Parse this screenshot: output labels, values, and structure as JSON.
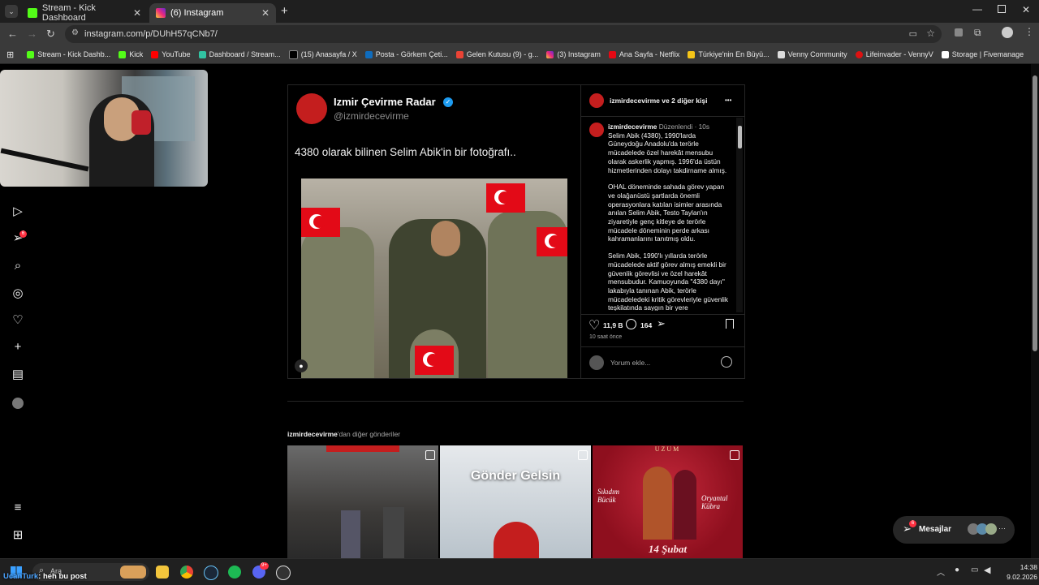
{
  "browser": {
    "tabs": [
      {
        "label": "Stream - Kick Dashboard",
        "active": false,
        "icon": "kick-icon"
      },
      {
        "label": "(6) Instagram",
        "active": true,
        "icon": "instagram-icon"
      }
    ],
    "new_tab_symbol": "+",
    "url": "instagram.com/p/DUhH57qCNb7/",
    "bookmarks": [
      "Stream - Kick Dashb...",
      "Kick",
      "YouTube",
      "Dashboard / Stream...",
      "(15) Anasayfa / X",
      "Posta - Görkem Çeti...",
      "Gelen Kutusu (9) - g...",
      "(3) Instagram",
      "Ana Sayfa - Netflix",
      "Türkiye'nin En Büyü...",
      "Venny Community",
      "Lifeinvader - VennyV",
      "Storage | Fivemanage"
    ]
  },
  "sidebar": {
    "notification_badge": "6"
  },
  "post": {
    "media": {
      "tweet_author": "Izmir Çevirme Radar",
      "tweet_handle": "@izmirdecevirme",
      "tweet_text": "4380 olarak bilinen Selim Abik'in bir fotoğrafı.."
    },
    "header": {
      "author_line": "izmirdecevirme ve 2 diğer kişi",
      "more": "•••"
    },
    "caption": {
      "username": "izmirdecevirme",
      "edited": "Düzenlendi",
      "dot": "·",
      "time": "10s",
      "p1": "Selim Abik (4380), 1990'larda Güneydoğu Anadolu'da terörle mücadelede özel harekât mensubu olarak askerlik yapmış. 1996'da üstün hizmetlerinden dolayı takdirname almış.",
      "p2": "OHAL döneminde sahada görev yapan ve olağanüstü şartlarda önemli operasyonlara katılan isimler arasında anılan Selim Abik, Testo Taylan'ın ziyaretiyle genç kitleye de terörle mücadele döneminin perde arkası kahramanlarını tanıtmış oldu.",
      "p3": "Selim Abik, 1990'lı yıllarda terörle mücadelede aktif görev almış emekli bir güvenlik görevlisi ve özel harekât mensubudur. Kamuoyunda \"4380 dayı\" lakabıyla tanınan Abik, terörle mücadeledeki kritik görevleriyle güvenlik teşkilatında saygın bir yere"
    },
    "actions": {
      "likes": "11,9 B",
      "comments": "164",
      "time_ago": "10 saat önce",
      "comment_placeholder": "Yorum ekle..."
    }
  },
  "more_posts": {
    "prefix": "izmirdecevirme",
    "suffix": "'dan diğer gönderiler",
    "tiles": [
      {
        "text": "",
        "bg": "#3c3a38"
      },
      {
        "text": "Gönder Gelsin",
        "bg": "#cfd4d8"
      },
      {
        "text_top": "UZUM",
        "left_name": "Sıkıdım Bücük",
        "right_name": "Oryantal Kübra",
        "date": "14 Şubat",
        "bg": "#8e0f1e"
      }
    ]
  },
  "messages": {
    "label": "Mesajlar",
    "badge": "6"
  },
  "taskbar": {
    "search_placeholder": "Ara",
    "chat_user": "UcanTurk",
    "chat_message": "heh bu post",
    "time": "14:38",
    "date": "9.02.2026",
    "discord_badge": "9+"
  },
  "colors": {
    "accent_red": "#ff3040",
    "verified_blue": "#1d9bf0",
    "kick_green": "#53fc18"
  }
}
